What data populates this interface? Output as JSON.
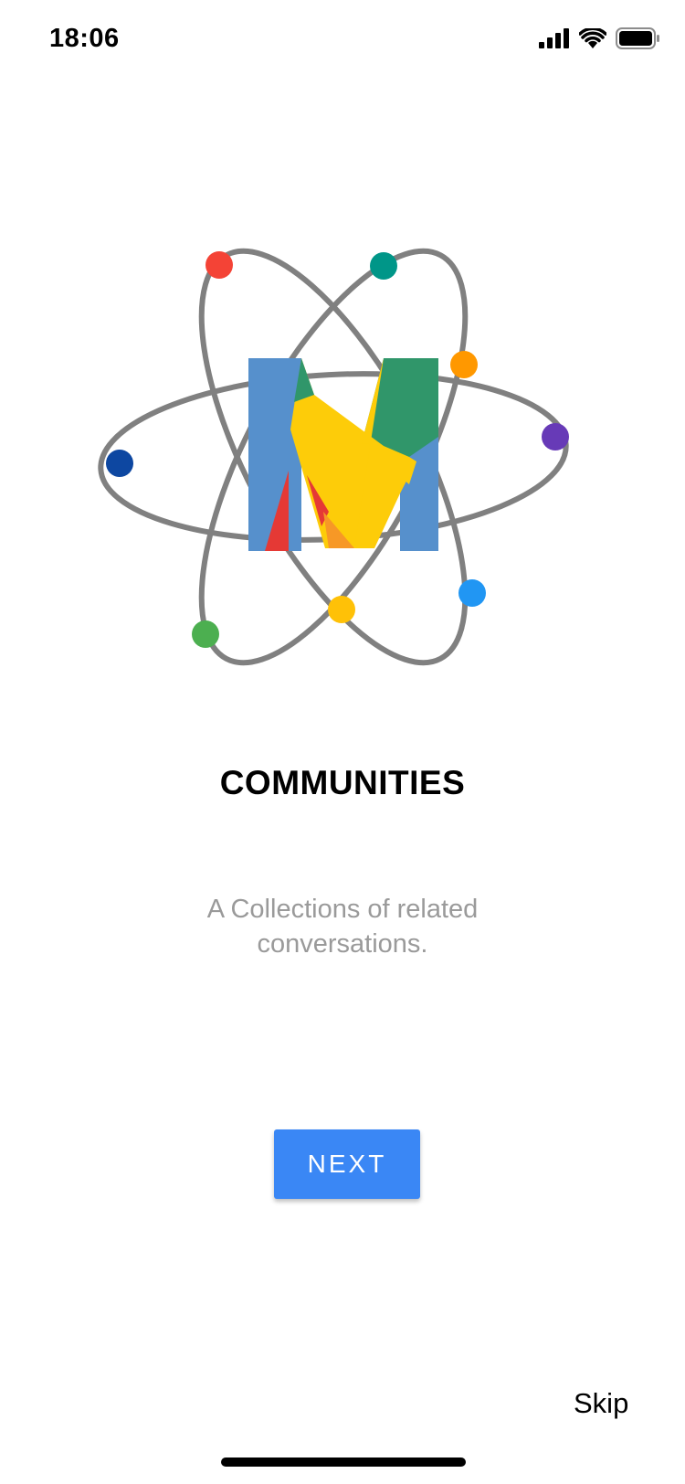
{
  "status_bar": {
    "time": "18:06",
    "icons": [
      "signal-icon",
      "wifi-icon",
      "battery-icon"
    ]
  },
  "onboarding": {
    "logo_icon": "atom-m-logo-icon",
    "title": "COMMUNITIES",
    "subtitle": "A Collections of related conversations.",
    "next_label": "NEXT",
    "skip_label": "Skip"
  },
  "colors": {
    "primary_button": "#3a87f5",
    "subtitle_text": "#9a9a9a",
    "orbit": "#808080"
  }
}
